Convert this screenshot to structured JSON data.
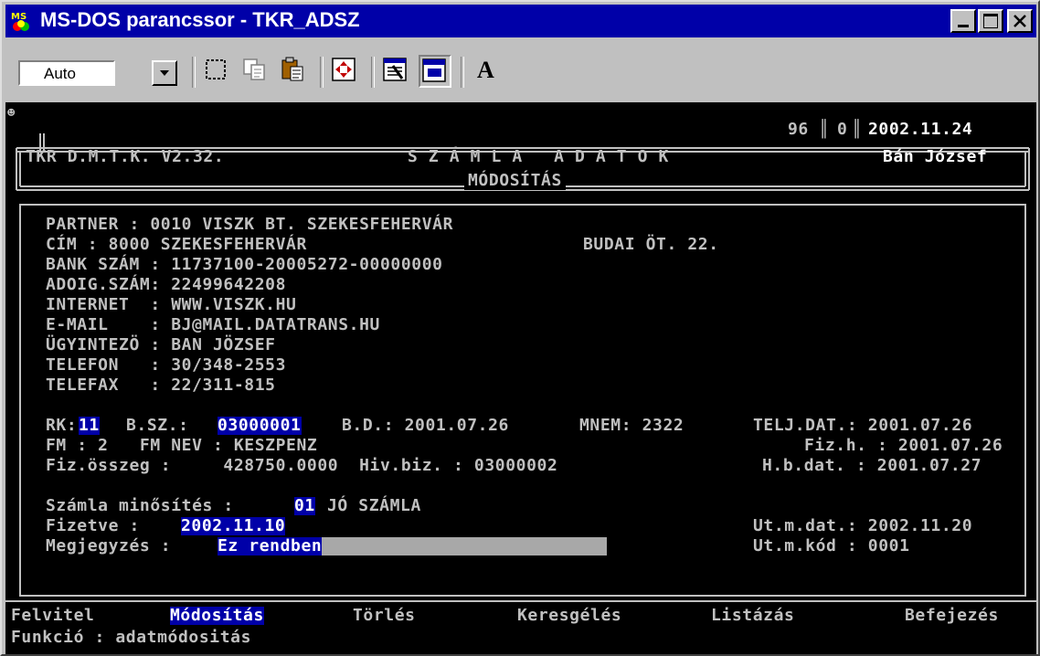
{
  "window": {
    "title": "MS-DOS parancssor - TKR_ADSZ",
    "icon": "msdos-icon",
    "controls": [
      "minimize-button",
      "maximize-button",
      "close-button"
    ]
  },
  "toolbar": {
    "font_size_value": "Auto",
    "icons": [
      "mark-icon",
      "copy-icon",
      "paste-icon",
      "fullscreen-icon",
      "properties-icon",
      "background-icon",
      "font-icon"
    ],
    "font_button_label": "A"
  },
  "header": {
    "app": "TKR D.M.T.K. V2.32.",
    "title": "S Z Á M L A   A D A T O K",
    "subtitle": "MÓDOSÍTÁS",
    "counter1": "96",
    "counter2": "0",
    "date": "2002.11.24",
    "user": "Bán József"
  },
  "partner": {
    "line1": "PARTNER : 0010 VISZK BT. SZEKESFEHERVÁR",
    "line2_left": "CÍM : 8000 SZEKESFEHERVÁR",
    "line2_right": "BUDAI ÖT. 22.",
    "line3": "BANK SZÁM : 11737100-20005272-00000000",
    "line4": "ADOIG.SZÁM: 22499642208",
    "line5": "INTERNET  : WWW.VISZK.HU",
    "line6": "E-MAIL    : BJ@MAIL.DATATRANS.HU",
    "line7": "ÜGYINTEZÖ : BAN JÖZSEF",
    "line8": "TELEFON   : 30/348-2553",
    "line9": "TELEFAX   : 22/311-815"
  },
  "invoice": {
    "rk_label": "RK:",
    "rk_value": "11",
    "bsz_label": "B.SZ.:",
    "bsz_value": "03000001",
    "bd": "B.D.: 2001.07.26",
    "mnem": "MNEM: 2322",
    "telj": "TELJ.DAT.: 2001.07.26",
    "fm": "FM : 2   FM NEV : KESZPENZ",
    "fizh": "Fiz.h. : 2001.07.26",
    "fizosszeg": "Fiz.összeg :     428750.0000  Hiv.biz. : 03000002",
    "hbdat": "H.b.dat. : 2001.07.27",
    "minosites_label": "Számla minősítés :",
    "minosites_code": "01",
    "minosites_text": "JÓ SZÁMLA",
    "fizetve_label": "Fizetve :",
    "fizetve_value": "2002.11.10",
    "megjegyzes_label": "Megjegyzés :",
    "megjegyzes_value": "Ez rendben",
    "utmdat": "Ut.m.dat.: 2002.11.20",
    "utmkod": "Ut.m.kód : 0001"
  },
  "menu": {
    "items": [
      "Felvitel",
      "Módosítás",
      "Törlés",
      "Keresgélés",
      "Listázás",
      "Befejezés"
    ],
    "active": "Módosítás",
    "function": "Funkció : adatmódositás"
  }
}
